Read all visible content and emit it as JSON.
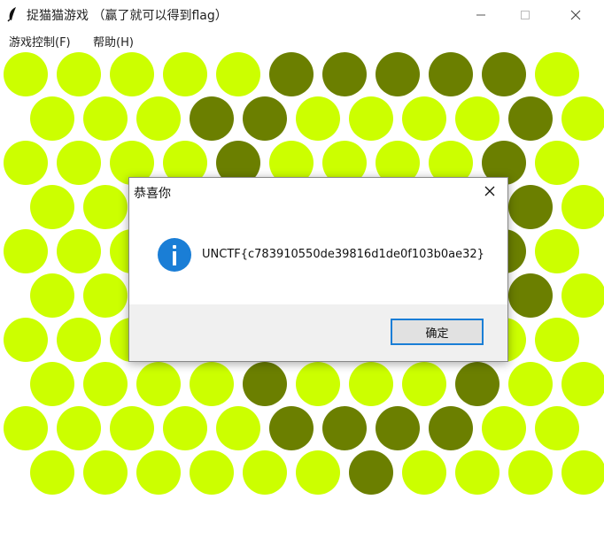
{
  "window": {
    "title": "捉猫猫游戏 （赢了就可以得到flag）",
    "controls": {
      "minimize": "—",
      "maximize": "☐",
      "close": "✕"
    }
  },
  "menu": {
    "items": [
      {
        "label": "游戏控制(F)"
      },
      {
        "label": "帮助(H)"
      }
    ]
  },
  "board": {
    "colors": {
      "empty": "#ccff00",
      "blocked": "#6b7f00"
    },
    "rows": 10,
    "cols": 11,
    "blocked": [
      [
        0,
        5
      ],
      [
        0,
        6
      ],
      [
        0,
        7
      ],
      [
        0,
        8
      ],
      [
        0,
        9
      ],
      [
        1,
        3
      ],
      [
        1,
        4
      ],
      [
        1,
        9
      ],
      [
        2,
        4
      ],
      [
        2,
        9
      ],
      [
        3,
        9
      ],
      [
        4,
        9
      ],
      [
        5,
        9
      ],
      [
        6,
        8
      ],
      [
        7,
        4
      ],
      [
        7,
        8
      ],
      [
        8,
        5
      ],
      [
        8,
        6
      ],
      [
        8,
        7
      ],
      [
        8,
        8
      ],
      [
        9,
        6
      ]
    ]
  },
  "dialog": {
    "title": "恭喜你",
    "message": "UNCTF{c783910550de39816d1de0f103b0ae32}",
    "ok_label": "确定",
    "icon": "info-icon"
  }
}
